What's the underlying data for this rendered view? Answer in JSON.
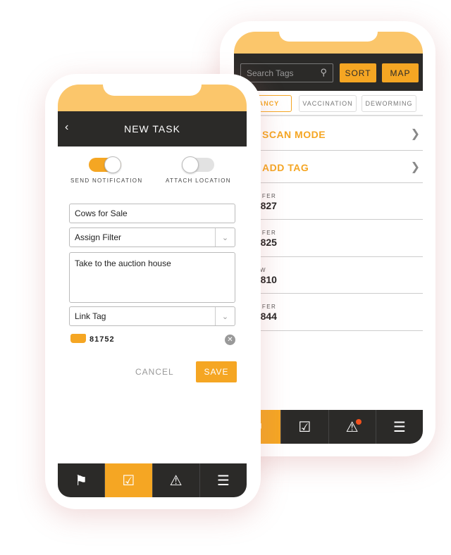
{
  "back": {
    "search_placeholder": "Search Tags",
    "sort": "SORT",
    "map": "MAP",
    "chips": [
      "PREGNANCY",
      "VACCINATION",
      "DEWORMING"
    ],
    "scan_mode": "SCAN MODE",
    "add_tag": "ADD TAG",
    "tags": [
      {
        "kind": "HEIFER",
        "id": "03827"
      },
      {
        "kind": "HEIFER",
        "id": "03825"
      },
      {
        "kind": "COW",
        "id": "04810"
      },
      {
        "kind": "HEIFER",
        "id": "05844"
      }
    ],
    "nav": [
      "tag-icon",
      "tasks-icon",
      "alert-icon",
      "menu-icon"
    ],
    "active_nav": 0
  },
  "front": {
    "title": "NEW TASK",
    "send_notification": "SEND NOTIFICATION",
    "send_notification_on": true,
    "attach_location": "ATTACH LOCATION",
    "attach_location_on": false,
    "task_name": "Cows for Sale",
    "filter": "Assign Filter",
    "notes": "Take to the auction house",
    "link_tag": "Link Tag",
    "linked_tag": "81752",
    "cancel": "CANCEL",
    "save": "SAVE",
    "nav": [
      "tag-icon",
      "tasks-icon",
      "alert-icon",
      "menu-icon"
    ],
    "active_nav": 1
  },
  "colors": {
    "accent": "#f5a623",
    "header": "#2b2a28",
    "top": "#fbc66b",
    "alert_dot": "#f4511e"
  }
}
